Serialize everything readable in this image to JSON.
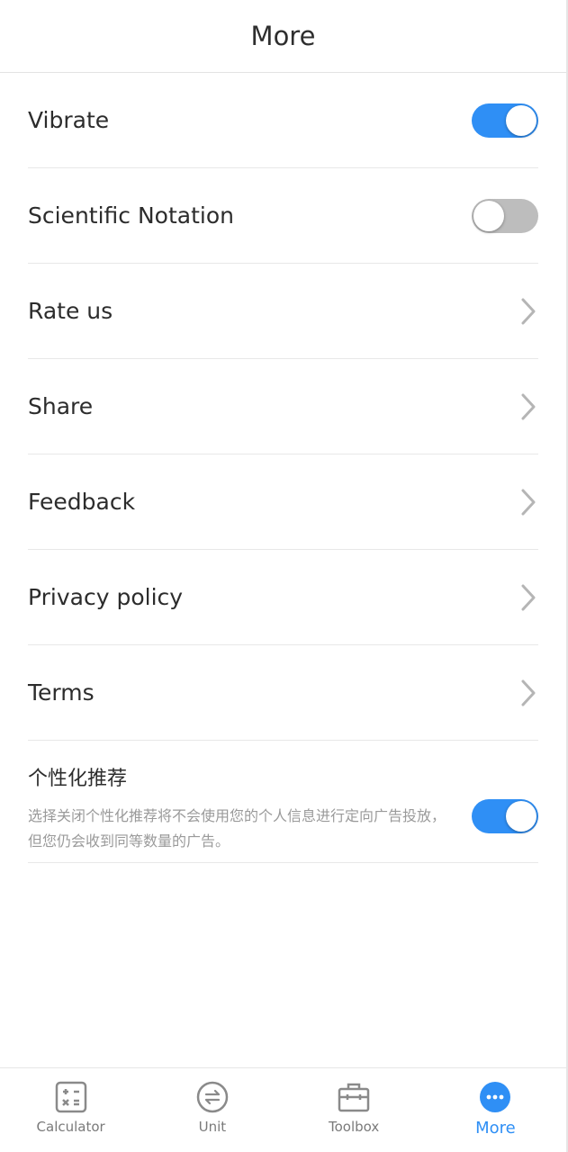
{
  "header": {
    "title": "More"
  },
  "settings": [
    {
      "label": "Vibrate",
      "type": "toggle",
      "state": "on"
    },
    {
      "label": "Scientific Notation",
      "type": "toggle",
      "state": "off"
    },
    {
      "label": "Rate us",
      "type": "link"
    },
    {
      "label": "Share",
      "type": "link"
    },
    {
      "label": "Feedback",
      "type": "link"
    },
    {
      "label": "Privacy policy",
      "type": "link"
    },
    {
      "label": "Terms",
      "type": "link"
    }
  ],
  "personalized": {
    "label": "个性化推荐",
    "description": "选择关闭个性化推荐将不会使用您的个人信息进行定向广告投放，但您仍会收到同等数量的广告。",
    "state": "on"
  },
  "tabs": [
    {
      "label": "Calculator",
      "icon": "calculator-icon",
      "active": false
    },
    {
      "label": "Unit",
      "icon": "unit-convert-icon",
      "active": false
    },
    {
      "label": "Toolbox",
      "icon": "toolbox-icon",
      "active": false
    },
    {
      "label": "More",
      "icon": "more-dots-icon",
      "active": true
    }
  ],
  "colors": {
    "accent": "#2f8ff5",
    "toggle_off": "#bdbdbd",
    "text": "#2c2c2c",
    "muted": "#9a9a9a"
  }
}
